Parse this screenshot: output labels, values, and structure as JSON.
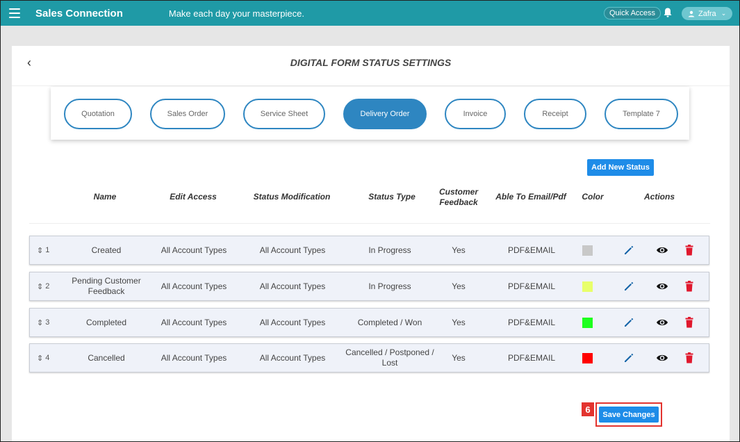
{
  "topbar": {
    "brand": "Sales Connection",
    "tagline": "Make each day your masterpiece.",
    "quick_access": "Quick Access",
    "user_name": "Zafra",
    "accent_color": "#1f9aa6"
  },
  "page": {
    "title": "DIGITAL FORM STATUS SETTINGS",
    "back_icon": "chevron-left-icon"
  },
  "tabs": [
    {
      "label": "Quotation",
      "active": false
    },
    {
      "label": "Sales Order",
      "active": false
    },
    {
      "label": "Service Sheet",
      "active": false
    },
    {
      "label": "Delivery Order",
      "active": true
    },
    {
      "label": "Invoice",
      "active": false
    },
    {
      "label": "Receipt",
      "active": false
    },
    {
      "label": "Template 7",
      "active": false
    }
  ],
  "add_button": "Add New Status",
  "columns": {
    "name": "Name",
    "edit_access": "Edit Access",
    "status_modification": "Status Modification",
    "status_type": "Status Type",
    "customer_feedback_1": "Customer",
    "customer_feedback_2": "Feedback",
    "email_pdf": "Able To Email/Pdf",
    "color": "Color",
    "actions": "Actions"
  },
  "rows": [
    {
      "order": "1",
      "name": "Created",
      "name_2": "",
      "edit_access": "All Account Types",
      "status_modification": "All Account Types",
      "status_type": "In Progress",
      "status_type_2": "",
      "customer_feedback": "Yes",
      "email_pdf": "PDF&EMAIL",
      "color": "#c8c8c8"
    },
    {
      "order": "2",
      "name": "Pending Customer",
      "name_2": "Feedback",
      "edit_access": "All Account Types",
      "status_modification": "All Account Types",
      "status_type": "In Progress",
      "status_type_2": "",
      "customer_feedback": "Yes",
      "email_pdf": "PDF&EMAIL",
      "color": "#e8ff6a"
    },
    {
      "order": "3",
      "name": "Completed",
      "name_2": "",
      "edit_access": "All Account Types",
      "status_modification": "All Account Types",
      "status_type": "Completed / Won",
      "status_type_2": "",
      "customer_feedback": "Yes",
      "email_pdf": "PDF&EMAIL",
      "color": "#1eff1e"
    },
    {
      "order": "4",
      "name": "Cancelled",
      "name_2": "",
      "edit_access": "All Account Types",
      "status_modification": "All Account Types",
      "status_type": "Cancelled / Postponed /",
      "status_type_2": "Lost",
      "customer_feedback": "Yes",
      "email_pdf": "PDF&EMAIL",
      "color": "#ff0000"
    }
  ],
  "row_icons": {
    "edit": "pencil-icon",
    "view": "eye-icon",
    "delete": "trash-icon",
    "drag": "sort-handle-icon"
  },
  "save_button": "Save Changes",
  "step_badge": "6"
}
